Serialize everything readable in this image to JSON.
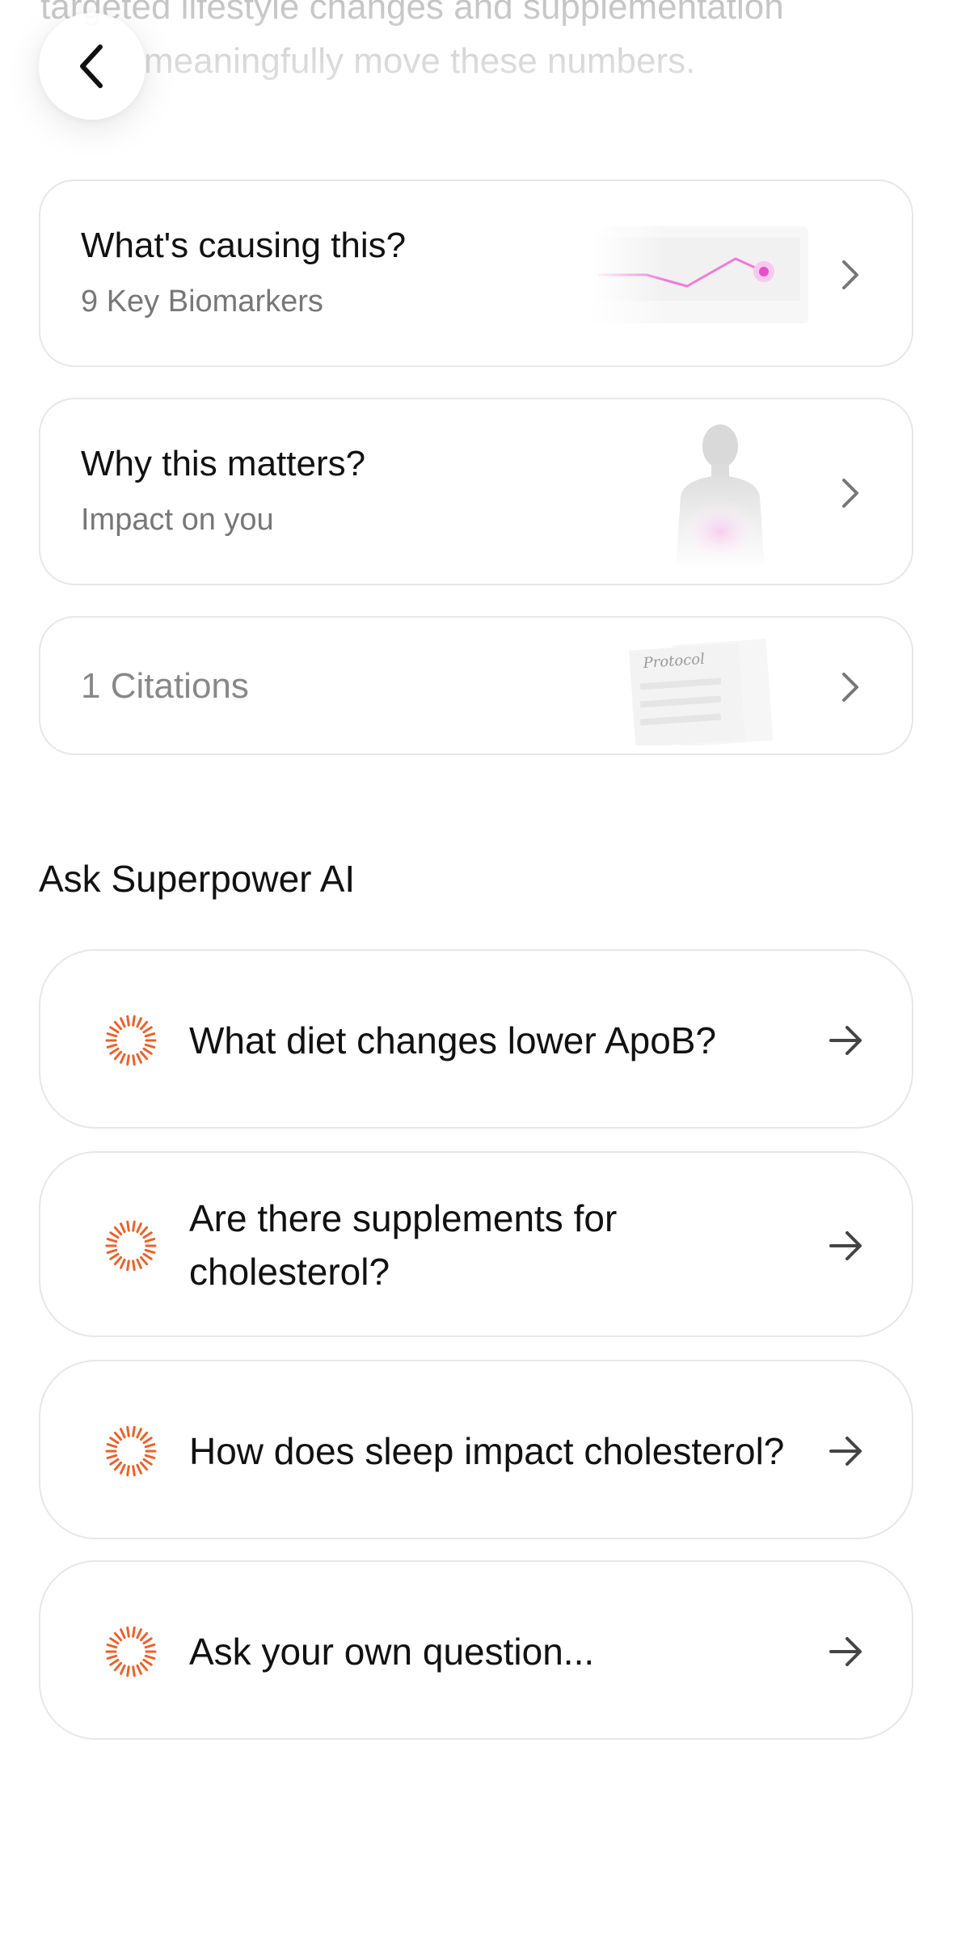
{
  "intro": {
    "line1": "targeted lifestyle changes and supplementation",
    "line2": "meaningfully move these numbers."
  },
  "icons": {
    "back": "chevron-left-icon",
    "chevron": "chevron-right-icon",
    "arrow": "arrow-right-icon",
    "spark": "sparkle-ring-icon"
  },
  "colors": {
    "accent_orange": "#e8622c",
    "chart_pink": "#ee7bd8",
    "border": "#e7e7e7",
    "muted_text": "#777777"
  },
  "cards": {
    "causing": {
      "title": "What's causing this?",
      "subtitle": "9 Key Biomarkers"
    },
    "matters": {
      "title": "Why this matters?",
      "subtitle": "Impact on you"
    },
    "citations": {
      "label": "1 Citations",
      "doc_label": "Protocol"
    }
  },
  "ask": {
    "section_title": "Ask Superpower AI",
    "questions": [
      {
        "text": "What diet changes lower ApoB?"
      },
      {
        "line1": "Are there supplements for",
        "line2": "cholesterol?"
      },
      {
        "text": "How does sleep impact cholesterol?"
      },
      {
        "text": "Ask your own question..."
      }
    ]
  }
}
